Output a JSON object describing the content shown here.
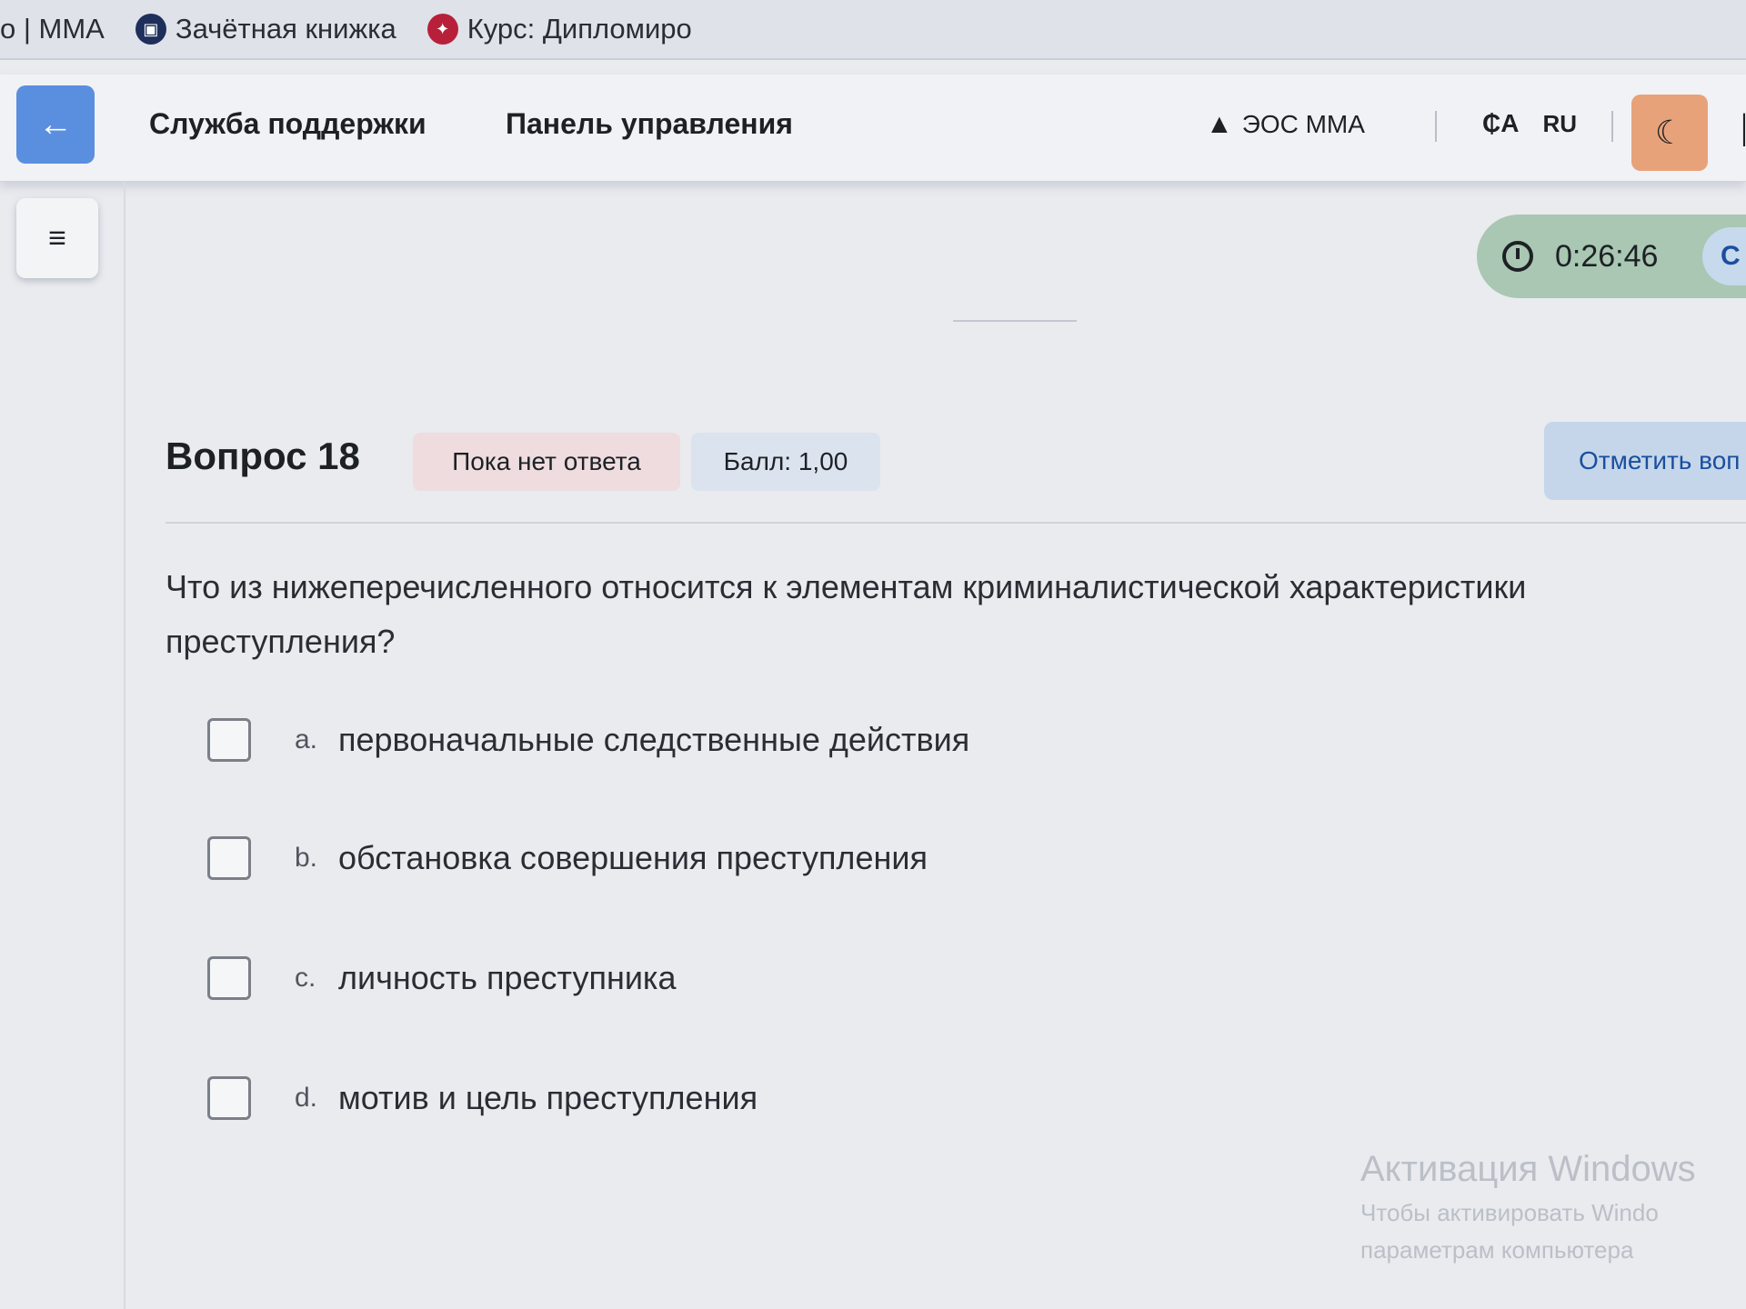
{
  "bookmarks": {
    "site": "о | ММА",
    "record_book": "Зачётная книжка",
    "course": "Курс: Дипломиро"
  },
  "navbar": {
    "back_icon": "←",
    "support": "Служба поддержки",
    "panel": "Панель управления",
    "eos": "ЭОС ММА",
    "language": "RU",
    "theme_icon": "moon-icon",
    "accent_color": "#5a8fe0",
    "theme_color": "#e8a27a"
  },
  "drawer_icon": "≡",
  "timer": {
    "value": "0:26:46",
    "close_label": "C"
  },
  "question": {
    "title": "Вопрос 18",
    "status": "Пока нет ответа",
    "score": "Балл: 1,00",
    "flag_label": "Отметить воп",
    "text": "Что из нижеперечисленного относится к элементам криминалистической характеристики преступления?",
    "answers": [
      {
        "letter": "a.",
        "text": "первоначальные следственные действия"
      },
      {
        "letter": "b.",
        "text": "обстановка совершения преступления"
      },
      {
        "letter": "c.",
        "text": "личность преступника"
      },
      {
        "letter": "d.",
        "text": "мотив и цель преступления"
      }
    ]
  },
  "watermark": {
    "title": "Активация Windows",
    "line1": "Чтобы активировать Windo",
    "line2": "параметрам компьютера"
  }
}
